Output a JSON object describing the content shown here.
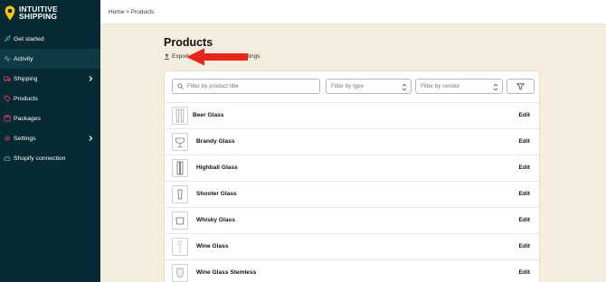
{
  "brand": {
    "line1": "INTUITIVE",
    "line2": "SHIPPING",
    "accent": "#f5c518"
  },
  "sidebar": {
    "items": [
      {
        "label": "Get started",
        "icon": "rocket-icon"
      },
      {
        "label": "Activity",
        "icon": "activity-icon",
        "active": true
      },
      {
        "label": "Shipping",
        "icon": "truck-icon",
        "chevron": true
      },
      {
        "label": "Products",
        "icon": "tag-icon"
      },
      {
        "label": "Packages",
        "icon": "package-icon"
      },
      {
        "label": "Settings",
        "icon": "gear-icon",
        "chevron": true
      },
      {
        "label": "Shopify connection",
        "icon": "cloud-icon"
      }
    ]
  },
  "breadcrumb": {
    "home": "Home",
    "sep": ">",
    "current": "Products"
  },
  "page": {
    "title": "Products",
    "export_label": "Export",
    "settings_fragment": "ttings"
  },
  "filters": {
    "search_placeholder": "Filter by product title",
    "type_placeholder": "Filter by type",
    "vendor_placeholder": "Filter by vendor"
  },
  "products": [
    {
      "name": "Beer Glass",
      "edit": "Edit"
    },
    {
      "name": "Brandy Glass",
      "edit": "Edit"
    },
    {
      "name": "Highball Glass",
      "edit": "Edit"
    },
    {
      "name": "Shooter Glass",
      "edit": "Edit"
    },
    {
      "name": "Whisky Glass",
      "edit": "Edit"
    },
    {
      "name": "Wine Glass",
      "edit": "Edit"
    },
    {
      "name": "Wine Glass Stemless",
      "edit": "Edit"
    }
  ],
  "colors": {
    "sidebar": "#062a33",
    "sidebar_active": "#0f3b46",
    "background": "#f4ecdc",
    "arrow": "#e8261c",
    "icon_teal": "#3fb5b0"
  }
}
